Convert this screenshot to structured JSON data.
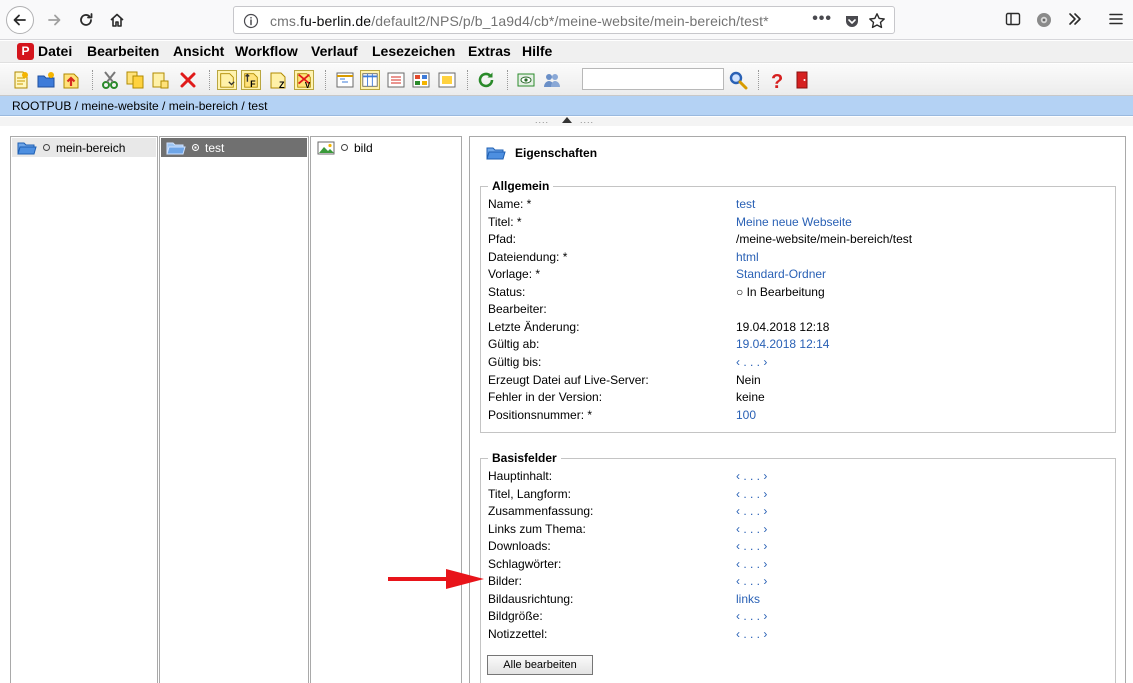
{
  "browser": {
    "url_prefix": "cms.",
    "url_host": "fu-berlin.de",
    "url_path": "/default2/NPS/p/b_1a9d4/cb*/meine-website/mein-bereich/test*",
    "url_dots": "•••"
  },
  "menu": {
    "items": [
      "Datei",
      "Bearbeiten",
      "Ansicht",
      "Workflow",
      "Verlauf",
      "Lesezeichen",
      "Extras",
      "Hilfe"
    ]
  },
  "toolbar": {
    "search_value": ""
  },
  "breadcrumb": "ROOTPUB / meine-website / mein-bereich / test",
  "columns": {
    "col1_node": "mein-bereich",
    "col2_node": "test",
    "col3_node": "bild"
  },
  "properties": {
    "title": "Eigenschaften",
    "allgemein": {
      "legend": "Allgemein",
      "rows": [
        {
          "label": "Name: *",
          "value": "test",
          "link": true
        },
        {
          "label": "Titel: *",
          "value": "Meine neue Webseite",
          "link": true
        },
        {
          "label": "Pfad:",
          "value": "/meine-website/mein-bereich/test",
          "link": false
        },
        {
          "label": "Dateiendung: *",
          "value": "html",
          "link": true
        },
        {
          "label": "Vorlage: *",
          "value": "Standard-Ordner",
          "link": true
        },
        {
          "label": "Status:",
          "value": "○ In Bearbeitung",
          "link": false
        },
        {
          "label": "Bearbeiter:",
          "value": "",
          "link": false
        },
        {
          "label": "Letzte Änderung:",
          "value": "19.04.2018 12:18",
          "link": false
        },
        {
          "label": "Gültig ab:",
          "value": "19.04.2018 12:14",
          "link": true
        },
        {
          "label": "Gültig bis:",
          "value": "‹ . . . ›",
          "link": true
        },
        {
          "label": "Erzeugt Datei auf Live-Server:",
          "value": "Nein",
          "link": false
        },
        {
          "label": "Fehler in der Version:",
          "value": "keine",
          "link": false
        },
        {
          "label": "Positionsnummer: *",
          "value": "100",
          "link": true
        }
      ]
    },
    "basisfelder": {
      "legend": "Basisfelder",
      "rows": [
        {
          "label": "Hauptinhalt:",
          "value": "‹ . . . ›",
          "link": true
        },
        {
          "label": "Titel, Langform:",
          "value": "‹ . . . ›",
          "link": true
        },
        {
          "label": "Zusammenfassung:",
          "value": "‹ . . . ›",
          "link": true
        },
        {
          "label": "Links zum Thema:",
          "value": "‹ . . . ›",
          "link": true
        },
        {
          "label": "Downloads:",
          "value": "‹ . . . ›",
          "link": true
        },
        {
          "label": "Schlagwörter:",
          "value": "‹ . . . ›",
          "link": true
        },
        {
          "label": "Bilder:",
          "value": "‹ . . . ›",
          "link": true
        },
        {
          "label": "Bildausrichtung:",
          "value": "links",
          "link": true
        },
        {
          "label": "Bildgröße:",
          "value": "‹ . . . ›",
          "link": true
        },
        {
          "label": "Notizzettel:",
          "value": "‹ . . . ›",
          "link": true
        }
      ],
      "edit_button": "Alle bearbeiten"
    }
  },
  "colors": {
    "link": "#2a61b5",
    "crumb_bg": "#b4d2f4",
    "arrow": "#e8141a"
  }
}
